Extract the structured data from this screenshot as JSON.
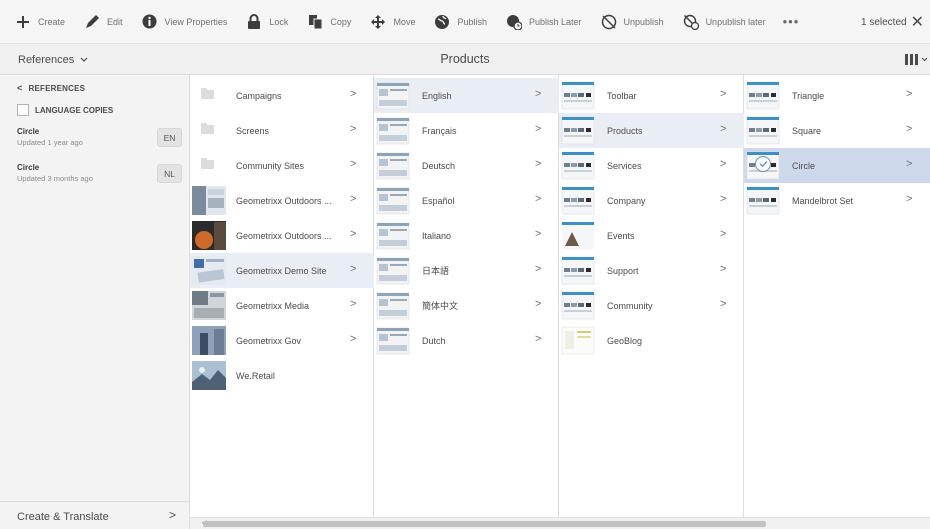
{
  "toolbar": {
    "actions": [
      {
        "label": "Create",
        "icon": "plus-icon"
      },
      {
        "label": "Edit",
        "icon": "pencil-icon"
      },
      {
        "label": "View Properties",
        "icon": "info-icon"
      },
      {
        "label": "Lock",
        "icon": "lock-icon"
      },
      {
        "label": "Copy",
        "icon": "copy-icon"
      },
      {
        "label": "Move",
        "icon": "move-icon"
      },
      {
        "label": "Publish",
        "icon": "globe-icon"
      },
      {
        "label": "Publish Later",
        "icon": "globe-clock-icon"
      },
      {
        "label": "Unpublish",
        "icon": "globe-off-icon"
      },
      {
        "label": "Unpublish later",
        "icon": "globe-off-clock-icon"
      }
    ],
    "more": "•••",
    "selected_count": "1 selected",
    "close": "✕"
  },
  "titlebar": {
    "rail_label": "References",
    "title": "Products"
  },
  "rail": {
    "back_label": "REFERENCES",
    "language_copies_label": "LANGUAGE COPIES",
    "items": [
      {
        "title": "Circle",
        "subtitle": "Updated 1 year ago",
        "lang": "EN"
      },
      {
        "title": "Circle",
        "subtitle": "Updated 3 months ago",
        "lang": "NL"
      }
    ],
    "bottom_label": "Create & Translate"
  },
  "columns": [
    {
      "items": [
        {
          "name": "Campaigns",
          "thumb": "folder",
          "arrow": true
        },
        {
          "name": "Screens",
          "thumb": "folder",
          "arrow": true
        },
        {
          "name": "Community Sites",
          "thumb": "folder",
          "arrow": true
        },
        {
          "name": "Geometrixx Outdoors ...",
          "thumb": "outdoor",
          "arrow": true
        },
        {
          "name": "Geometrixx Outdoors ...",
          "thumb": "outdoor2",
          "arrow": true
        },
        {
          "name": "Geometrixx Demo Site",
          "thumb": "demo",
          "arrow": true,
          "highlight": true
        },
        {
          "name": "Geometrixx Media",
          "thumb": "media",
          "arrow": true
        },
        {
          "name": "Geometrixx Gov",
          "thumb": "gov",
          "arrow": true
        },
        {
          "name": "We.Retail",
          "thumb": "retail",
          "arrow": false
        }
      ]
    },
    {
      "items": [
        {
          "name": "English",
          "thumb": "page",
          "arrow": true,
          "highlight": true
        },
        {
          "name": "Français",
          "thumb": "page",
          "arrow": true
        },
        {
          "name": "Deutsch",
          "thumb": "page",
          "arrow": true
        },
        {
          "name": "Español",
          "thumb": "page",
          "arrow": true
        },
        {
          "name": "Italiano",
          "thumb": "page",
          "arrow": true
        },
        {
          "name": "日本語",
          "thumb": "page",
          "arrow": true
        },
        {
          "name": "簡体中文",
          "thumb": "page",
          "arrow": true
        },
        {
          "name": "Dutch",
          "thumb": "page",
          "arrow": true
        }
      ]
    },
    {
      "items": [
        {
          "name": "Toolbar",
          "thumb": "site",
          "arrow": true
        },
        {
          "name": "Products",
          "thumb": "site",
          "arrow": true,
          "highlight": true
        },
        {
          "name": "Services",
          "thumb": "site",
          "arrow": true
        },
        {
          "name": "Company",
          "thumb": "site",
          "arrow": true
        },
        {
          "name": "Events",
          "thumb": "events",
          "arrow": true
        },
        {
          "name": "Support",
          "thumb": "site",
          "arrow": true
        },
        {
          "name": "Community",
          "thumb": "site",
          "arrow": true
        },
        {
          "name": "GeoBlog",
          "thumb": "blog",
          "arrow": false
        }
      ]
    },
    {
      "items": [
        {
          "name": "Triangle",
          "thumb": "site",
          "arrow": true
        },
        {
          "name": "Square",
          "thumb": "site",
          "arrow": true
        },
        {
          "name": "Circle",
          "thumb": "site",
          "arrow": true,
          "selected": true
        },
        {
          "name": "Mandelbrot Set",
          "thumb": "site",
          "arrow": true
        }
      ]
    }
  ],
  "colors": {
    "highlight": "#e9eef5",
    "selected": "#cdd9ea",
    "rail_bg": "#f3f3f3",
    "toolbar_bg": "#f5f5f5"
  }
}
